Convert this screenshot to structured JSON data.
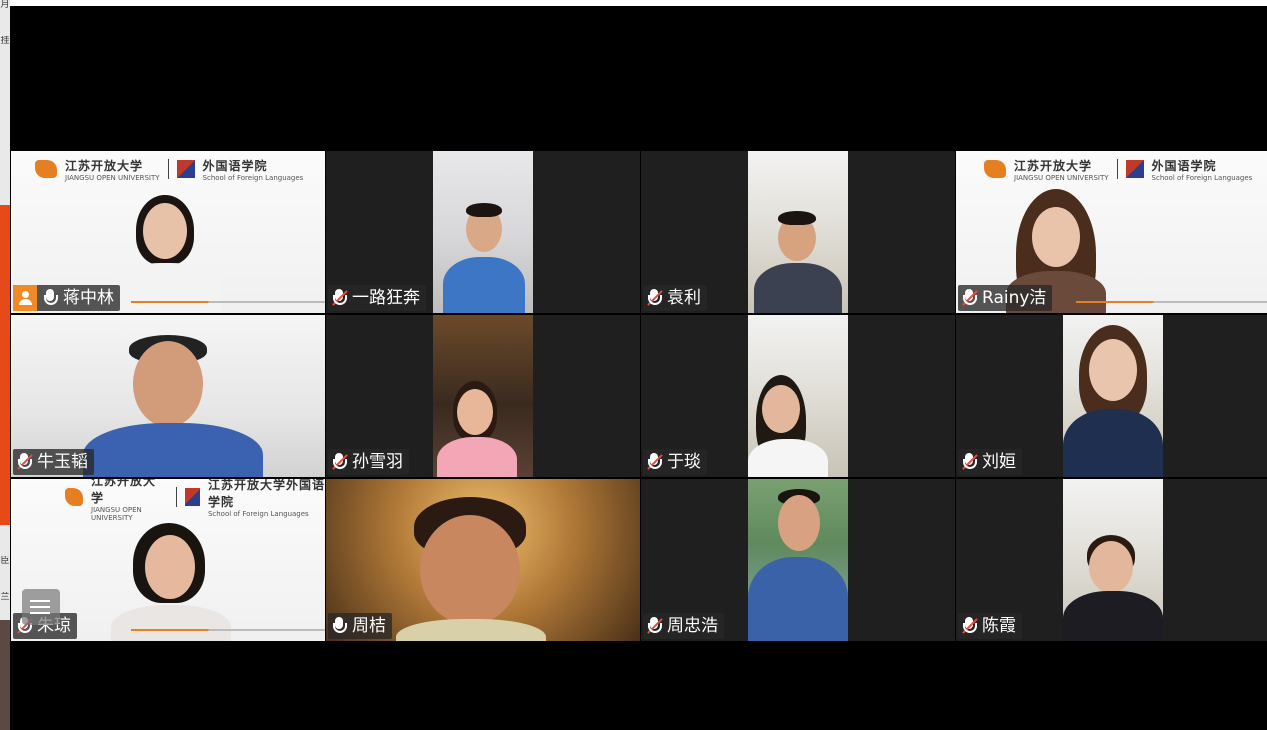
{
  "left_strip": {
    "glyphs": [
      "月",
      "挂",
      "臣",
      "兰"
    ]
  },
  "participants": [
    {
      "name": "蒋中林",
      "mic": "on",
      "host": true,
      "active": true,
      "bg": "slide"
    },
    {
      "name": "一路狂奔",
      "mic": "muted",
      "bg": "room"
    },
    {
      "name": "袁利",
      "mic": "muted",
      "bg": "shelf"
    },
    {
      "name": "Rainy洁",
      "mic": "muted",
      "bg": "slide"
    },
    {
      "name": "牛玉韬",
      "mic": "muted",
      "bg": "office"
    },
    {
      "name": "孙雪羽",
      "mic": "muted",
      "bg": "warm"
    },
    {
      "name": "于琰",
      "mic": "muted",
      "bg": "shelf"
    },
    {
      "name": "刘姮",
      "mic": "muted",
      "bg": "shelf"
    },
    {
      "name": "朱琼",
      "mic": "muted",
      "bg": "slide2"
    },
    {
      "name": "周桔",
      "mic": "on",
      "bg": "lamp"
    },
    {
      "name": "周忠浩",
      "mic": "muted",
      "bg": "outdoor"
    },
    {
      "name": "陈霞",
      "mic": "muted",
      "bg": "shelf"
    }
  ],
  "banner": {
    "university_cn": "江苏开放大学",
    "university_en": "JIANGSU OPEN UNIVERSITY",
    "school_cn": "外国语学院",
    "school_en": "School of Foreign Languages",
    "school_cn_long": "江苏开放大学外国语学院"
  },
  "colors": {
    "active_border": "#2ecc40",
    "host_badge": "#f08a24",
    "muted_slash": "#e74c3c",
    "grid_bg": "#000000"
  }
}
